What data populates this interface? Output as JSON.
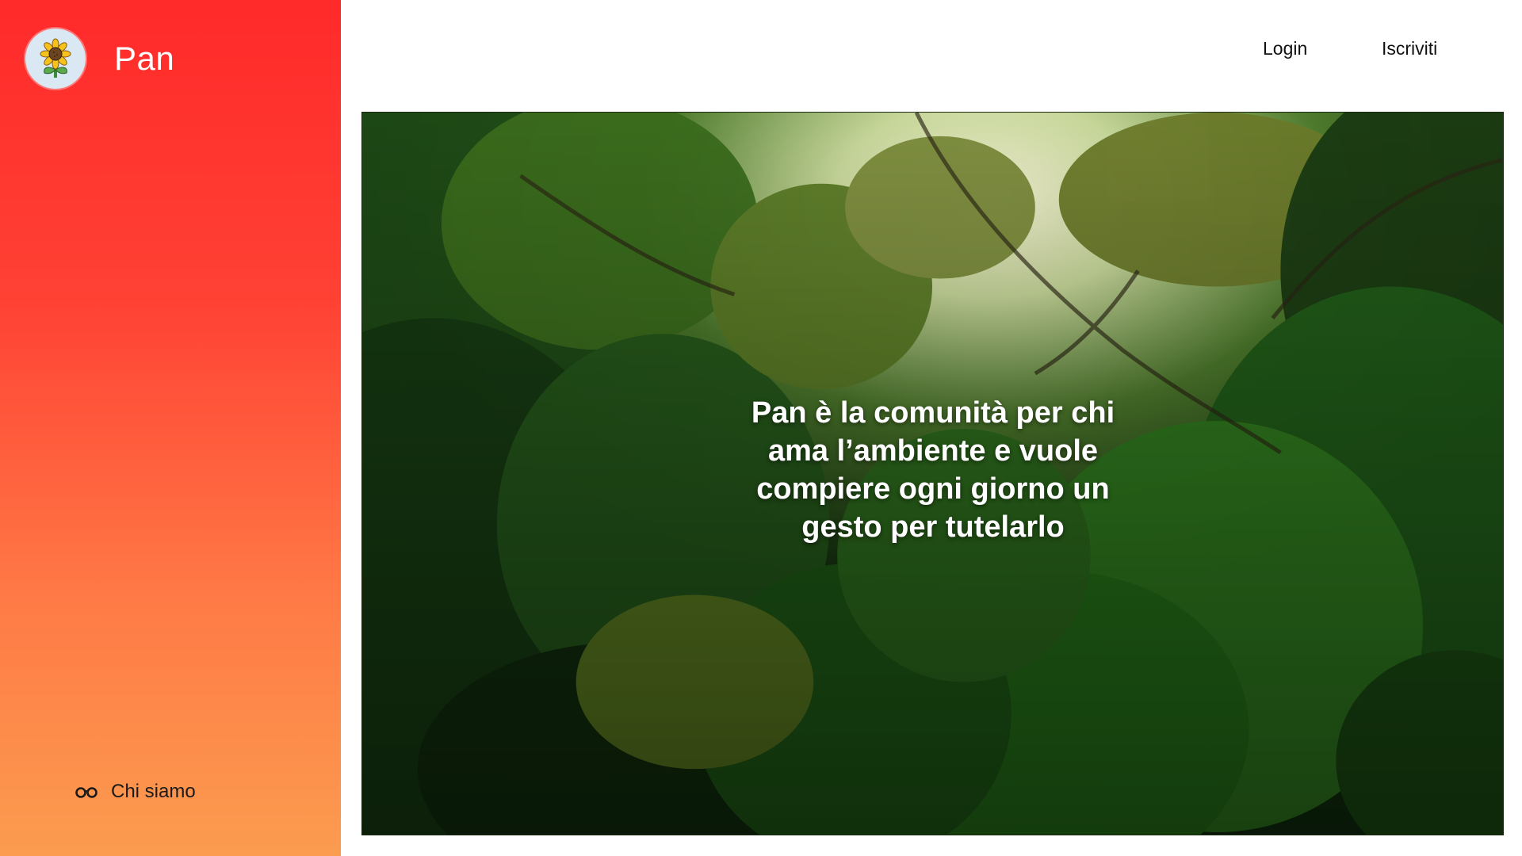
{
  "brand": {
    "name": "Pan",
    "logo_icon": "sunflower-icon"
  },
  "sidebar": {
    "items": [
      {
        "label": "Chi siamo",
        "icon": "glasses-icon"
      }
    ]
  },
  "topbar": {
    "login_label": "Login",
    "signup_label": "Iscriviti"
  },
  "hero": {
    "background": "forest canopy",
    "headline": "Pan è la comunità per chi ama l’ambiente e vuole compiere ogni giorno un gesto per tutelarlo"
  },
  "colors": {
    "sidebar_gradient_top": "#ff2a2a",
    "sidebar_gradient_bottom": "#fb9c4f",
    "text_dark": "#111111",
    "text_light": "#ffffff"
  }
}
